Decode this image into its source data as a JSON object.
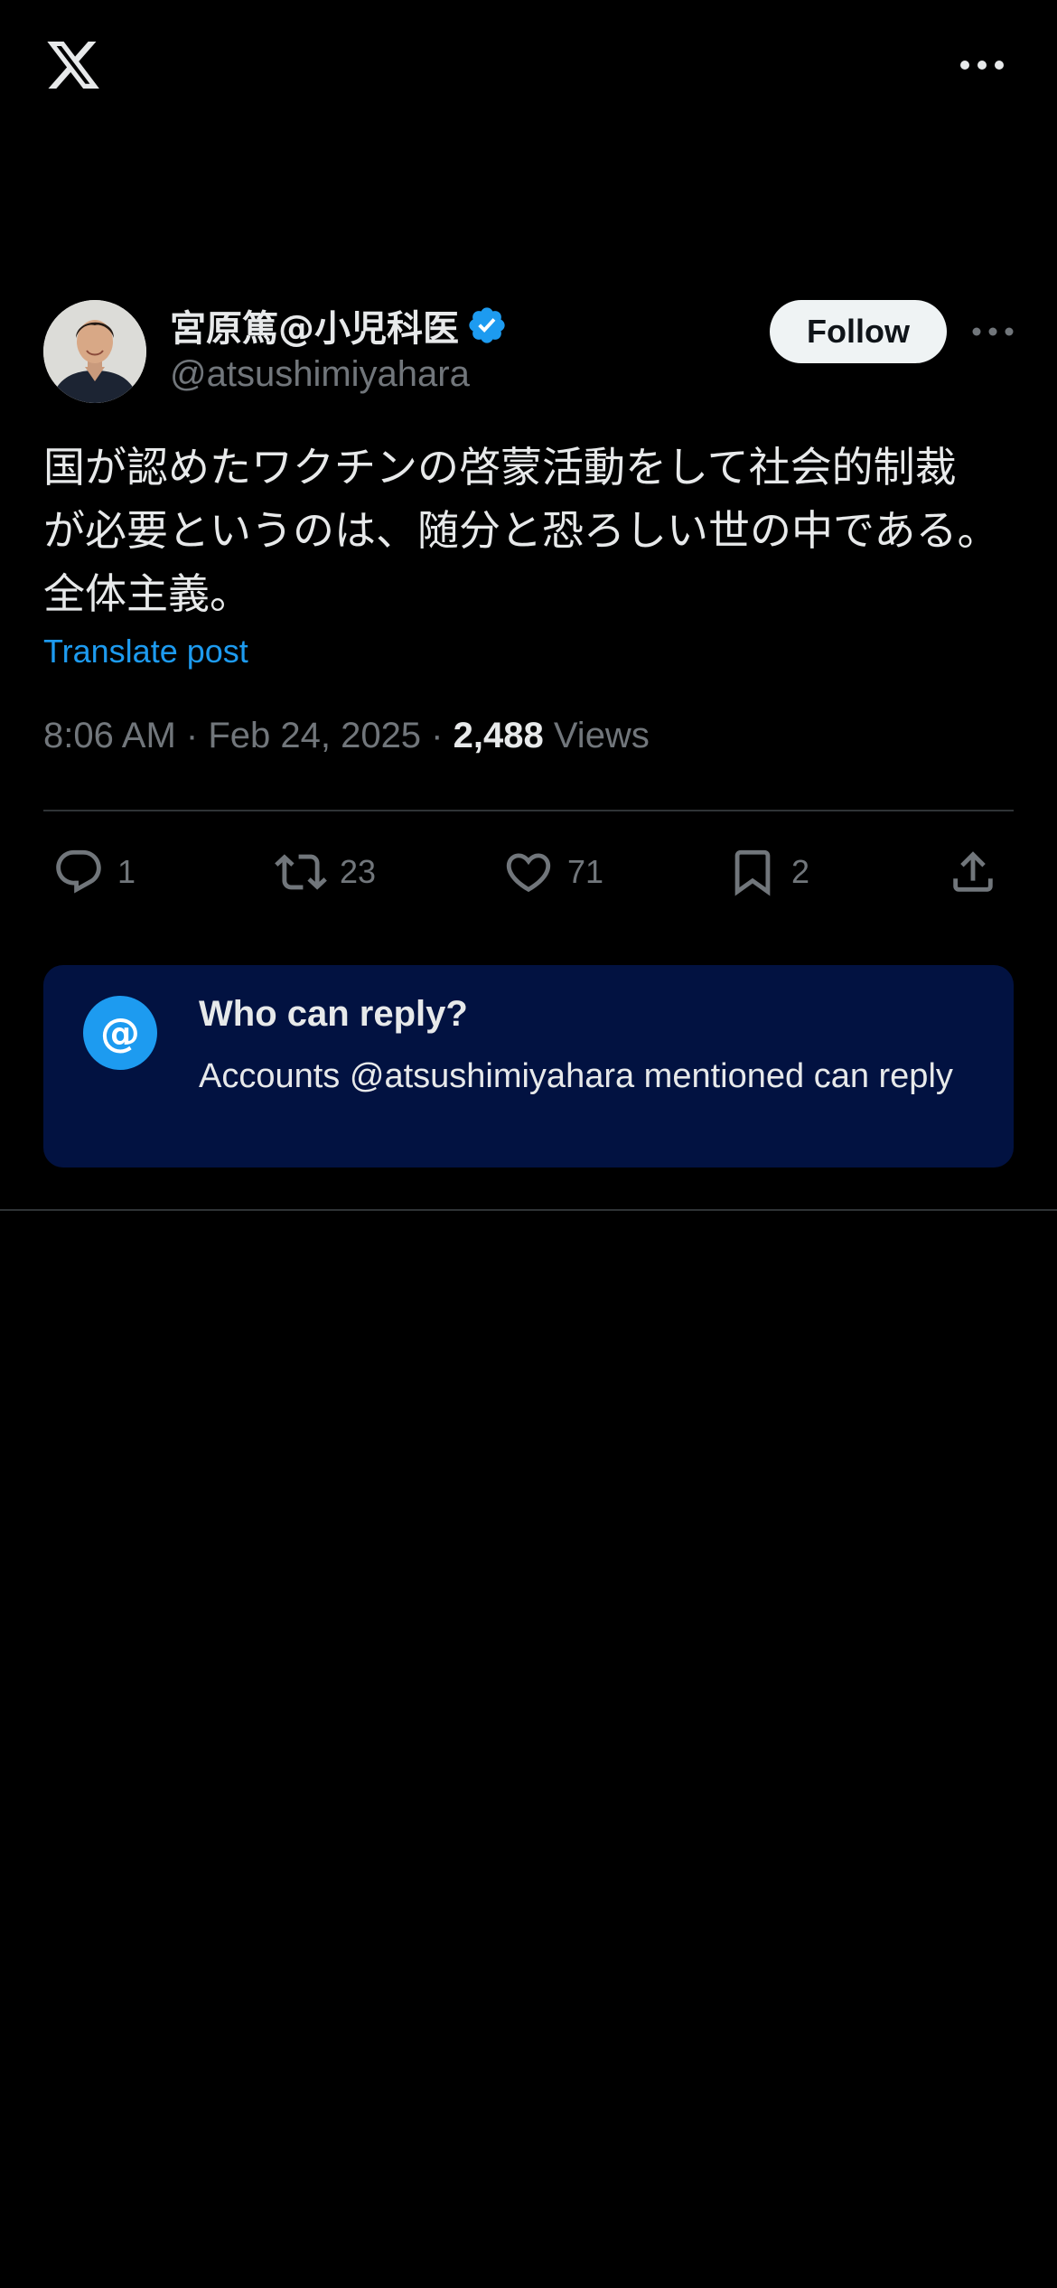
{
  "app": {
    "logo_icon": "x-logo-icon",
    "more_icon": "more-horizontal-icon"
  },
  "post": {
    "author": {
      "display_name": "宮原篤@小児科医",
      "handle": "@atsushimiyahara",
      "verified": true,
      "verified_color": "#1d9bf0",
      "avatar_icon": "avatar-photo"
    },
    "follow_label": "Follow",
    "text_lines": [
      "国が認めたワクチンの啓蒙活動をして社会的制裁",
      "が必要というのは、随分と恐ろしい世の中である。",
      "全体主義。"
    ],
    "translate_label": "Translate post",
    "time": "8:06 AM",
    "separator": " · ",
    "date": "Feb 24, 2025",
    "views_count": "2,488",
    "views_label": "Views",
    "actions": {
      "reply": {
        "icon": "reply-icon",
        "count": "1"
      },
      "repost": {
        "icon": "repost-icon",
        "count": "23"
      },
      "like": {
        "icon": "heart-icon",
        "count": "71"
      },
      "bookmark": {
        "icon": "bookmark-icon",
        "count": "2"
      },
      "share": {
        "icon": "share-icon"
      }
    }
  },
  "reply_restriction": {
    "icon": "at-sign-icon",
    "at_symbol": "@",
    "title": "Who can reply?",
    "description": "Accounts @atsushimiyahara mentioned can reply",
    "card_color": "#021241",
    "icon_color": "#1d9bf0"
  }
}
